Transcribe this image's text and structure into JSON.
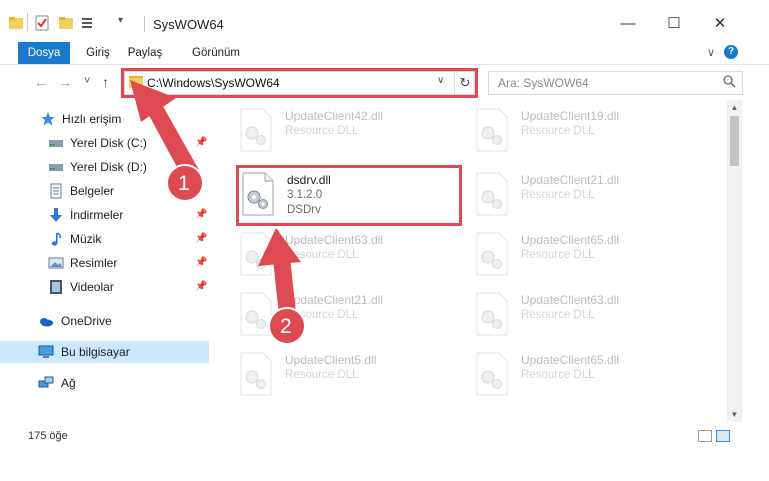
{
  "window": {
    "title": "SysWOW64",
    "minimize": "—",
    "maximize": "☐",
    "close": "✕"
  },
  "ribbon": {
    "tabs": [
      "Dosya",
      "Giriş",
      "Paylaş",
      "Görünüm"
    ],
    "expand": "∨",
    "help": "?"
  },
  "nav": {
    "back": "←",
    "forward": "→",
    "recent": "˅",
    "up": "↑",
    "address": "C:\\Windows\\SysWOW64",
    "address_dropdown": "∨",
    "refresh": "↻",
    "search_placeholder": "Ara: SysWOW64"
  },
  "sidebar": {
    "items": [
      {
        "label": "Hızlı erişim",
        "icon": "star-icon"
      },
      {
        "label": "Yerel Disk (C:)",
        "icon": "drive-icon"
      },
      {
        "label": "Yerel Disk (D:)",
        "icon": "drive-icon"
      },
      {
        "label": "Belgeler",
        "icon": "documents-icon"
      },
      {
        "label": "İndirmeler",
        "icon": "download-icon"
      },
      {
        "label": "Müzik",
        "icon": "music-icon"
      },
      {
        "label": "Resimler",
        "icon": "pictures-icon"
      },
      {
        "label": "Videolar",
        "icon": "videos-icon"
      },
      {
        "label": "OneDrive",
        "icon": "onedrive-icon"
      },
      {
        "label": "Bu bilgisayar",
        "icon": "computer-icon"
      },
      {
        "label": "Ağ",
        "icon": "network-icon"
      }
    ],
    "pin": "📌"
  },
  "files": [
    {
      "name": "UpdateClient42.dll",
      "line2": "Resource DLL",
      "line3": ""
    },
    {
      "name": "UpdateClient19.dll",
      "line2": "Resource DLL",
      "line3": ""
    },
    {
      "name": "dsdrv.dll",
      "line2": "3.1.2.0",
      "line3": "DSDrv"
    },
    {
      "name": "UpdateClient21.dll",
      "line2": "Resource DLL",
      "line3": ""
    },
    {
      "name": "UpdateClient63.dll",
      "line2": "Resource DLL",
      "line3": ""
    },
    {
      "name": "UpdateClient65.dll",
      "line2": "Resource DLL",
      "line3": ""
    },
    {
      "name": "UpdateClient21.dll",
      "line2": "Resource DLL",
      "line3": ""
    },
    {
      "name": "UpdateClient63.dll",
      "line2": "Resource DLL",
      "line3": ""
    },
    {
      "name": "UpdateClient5.dll",
      "line2": "Resource DLL",
      "line3": ""
    },
    {
      "name": "UpdateClient65.dll",
      "line2": "Resource DLL",
      "line3": ""
    }
  ],
  "annotations": {
    "step1": "1",
    "step2": "2",
    "color": "#de4a52"
  },
  "status": {
    "item_count": "175 öğe"
  }
}
